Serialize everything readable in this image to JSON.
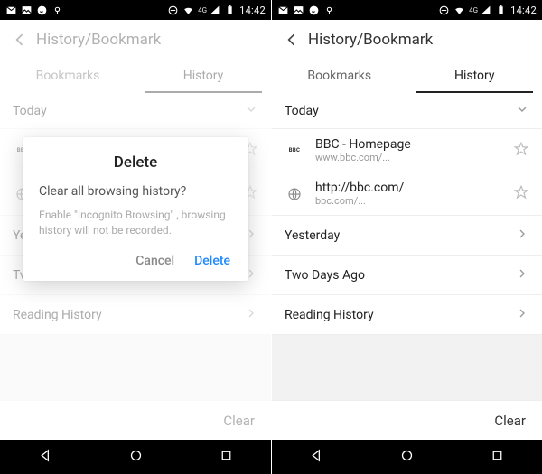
{
  "status": {
    "time": "14:42",
    "net_label": "4G"
  },
  "appbar": {
    "title": "History/Bookmark"
  },
  "tabs": {
    "bookmarks": "Bookmarks",
    "history": "History"
  },
  "sections": {
    "today": "Today",
    "yesterday": "Yesterday",
    "two_days_ago": "Two Days Ago",
    "reading_history": "Reading History"
  },
  "history_items": [
    {
      "title": "BBC - Homepage",
      "url": "www.bbc.com/..."
    },
    {
      "title": "http://bbc.com/",
      "url": "bbc.com/..."
    }
  ],
  "left_visible": {
    "item0_title": "BBC - Homepage",
    "yesterday_short": "Ye",
    "two_days_short": "Tv"
  },
  "bottom": {
    "clear": "Clear"
  },
  "dialog": {
    "title": "Delete",
    "message": "Clear all browsing history?",
    "hint": "Enable \"Incognito Browsing\" , browsing history will not be recorded.",
    "cancel": "Cancel",
    "confirm": "Delete"
  }
}
